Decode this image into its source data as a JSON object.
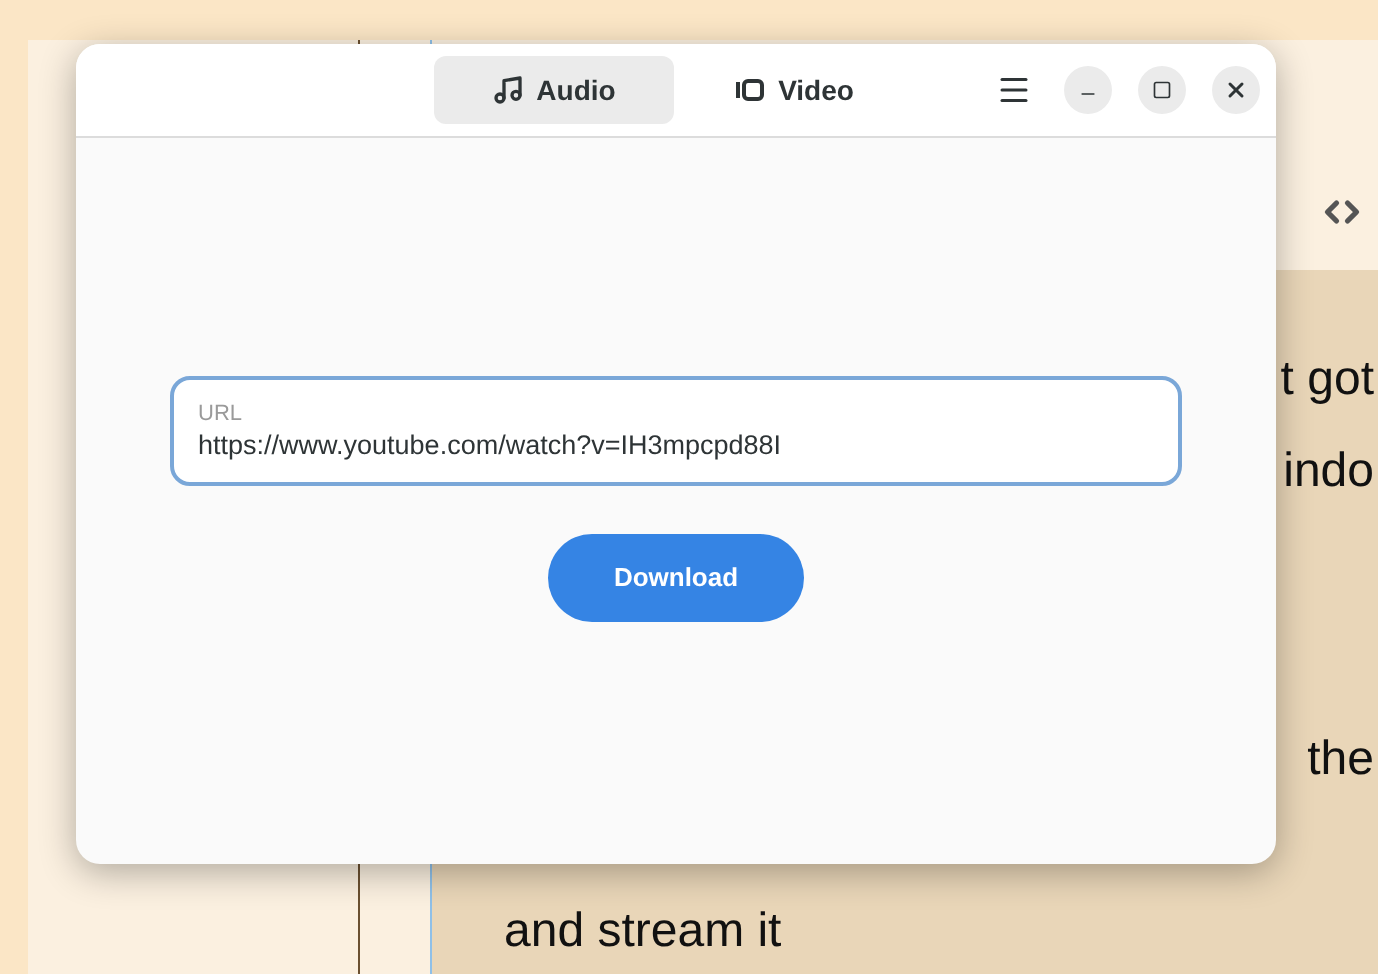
{
  "background_window": {
    "text_lines": [
      "t got",
      "indo",
      "the",
      "and stream it"
    ]
  },
  "window": {
    "tabs": [
      {
        "label": "Audio",
        "kind": "audio",
        "selected": true
      },
      {
        "label": "Video",
        "kind": "video",
        "selected": false
      }
    ]
  },
  "url_field": {
    "label": "URL",
    "value": "https://www.youtube.com/watch?v=IH3mpcpd88I"
  },
  "download_button": "Download"
}
